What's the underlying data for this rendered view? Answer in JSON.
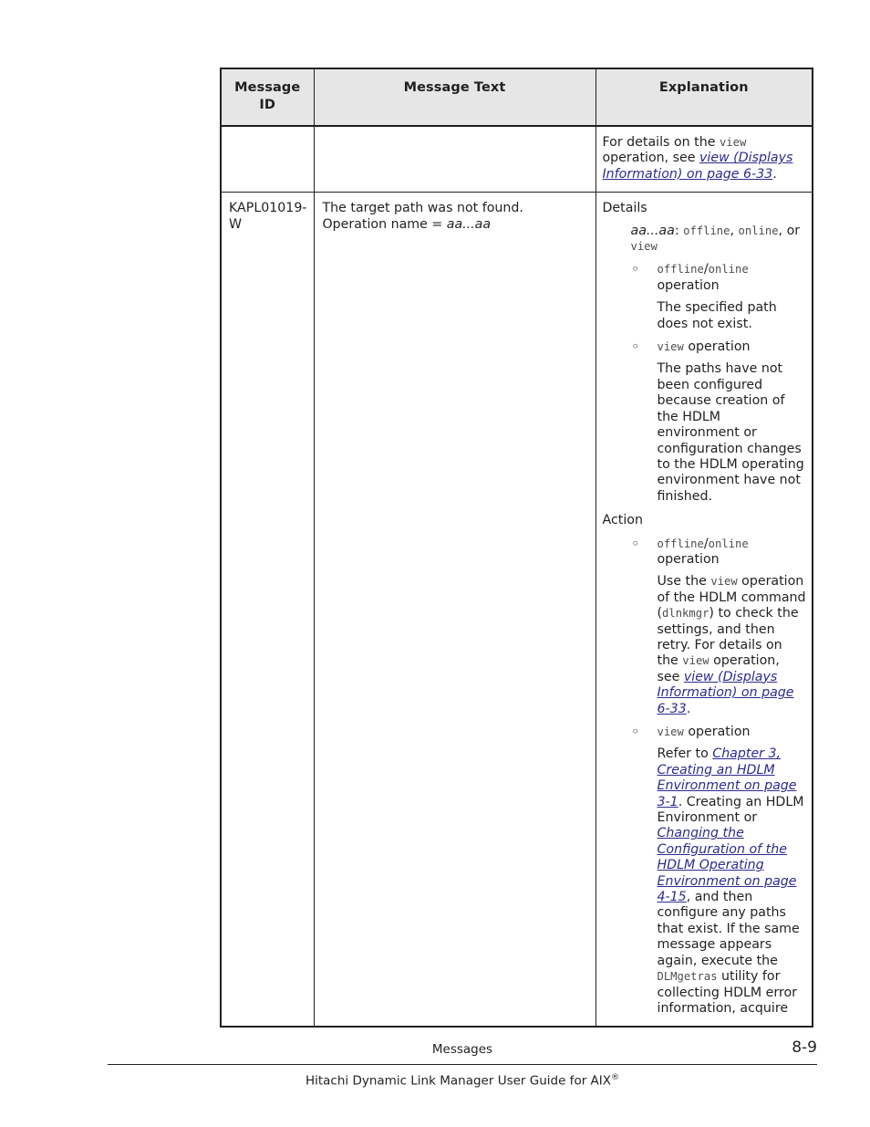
{
  "table": {
    "headers": [
      "Message\nID",
      "Message Text",
      "Explanation"
    ],
    "header_id_line1": "Message",
    "header_id_line2": "ID",
    "header_text": "Message Text",
    "header_explanation": "Explanation",
    "rows": [
      {
        "id": "",
        "text": "",
        "explanation_continued": {
          "l1": "For details on the ",
          "mono1": "view",
          "l2": " operation, see ",
          "link1": "view (Displays Information) on page 6-33",
          "l3": "."
        }
      },
      {
        "id": "KAPL01019-W",
        "text_plain": "The target path was not found. Operation name = ",
        "text_italic": "aa...aa",
        "explanation": {
          "details_label": "Details",
          "aa_label": "aa...aa",
          "aa_colon": ": ",
          "aa_val1": "offline",
          "aa_sep1": ", ",
          "aa_val2": "online",
          "aa_sep2": ", or ",
          "aa_val3": "view",
          "details_bullets": [
            {
              "head_mono1": "offline",
              "head_slash": "/",
              "head_mono2": "online",
              "head_tail": " operation",
              "body": "The specified path does not exist."
            },
            {
              "head_mono1": "view",
              "head_slash": "",
              "head_mono2": "",
              "head_tail": " operation",
              "body": "The paths have not been configured because creation of the HDLM environment or configuration changes to the HDLM operating environment have not finished."
            }
          ],
          "action_label": "Action",
          "action_bullets": [
            {
              "head_mono1": "offline",
              "head_slash": "/",
              "head_mono2": "online",
              "head_tail": " operation",
              "body_1": "Use the ",
              "body_mono_1": "view",
              "body_2": " operation of the HDLM command (",
              "body_mono_2": "dlnkmgr",
              "body_3": ") to check the settings, and then retry. For details on the ",
              "body_mono_3": "view",
              "body_4": " operation, see ",
              "body_link": "view (Displays Information) on page 6-33",
              "body_5": "."
            },
            {
              "head_mono1": "view",
              "head_slash": "",
              "head_mono2": "",
              "head_tail": " operation",
              "body_1": "Refer to ",
              "body_link_1": "Chapter 3, Creating an HDLM Environment on page 3-1",
              "body_2": ". Creating an HDLM Environment or ",
              "body_link_2": "Changing the Configuration of the HDLM Operating Environment on page 4-15",
              "body_3": ", and then configure any paths that exist. If the same message appears again, execute the ",
              "body_mono_1": "DLMgetras",
              "body_4": " utility for collecting HDLM error information, acquire"
            }
          ]
        }
      }
    ]
  },
  "footer": {
    "section": "Messages",
    "page_number": "8-9",
    "guide_title": "Hitachi Dynamic Link Manager User Guide for AIX",
    "guide_title_sup": "®"
  },
  "colors": {
    "link": "#2b2b8f",
    "mono": "#4d4d4d",
    "text": "#231f20",
    "header_bg": "#e6e6e6",
    "border": "#231f20"
  }
}
